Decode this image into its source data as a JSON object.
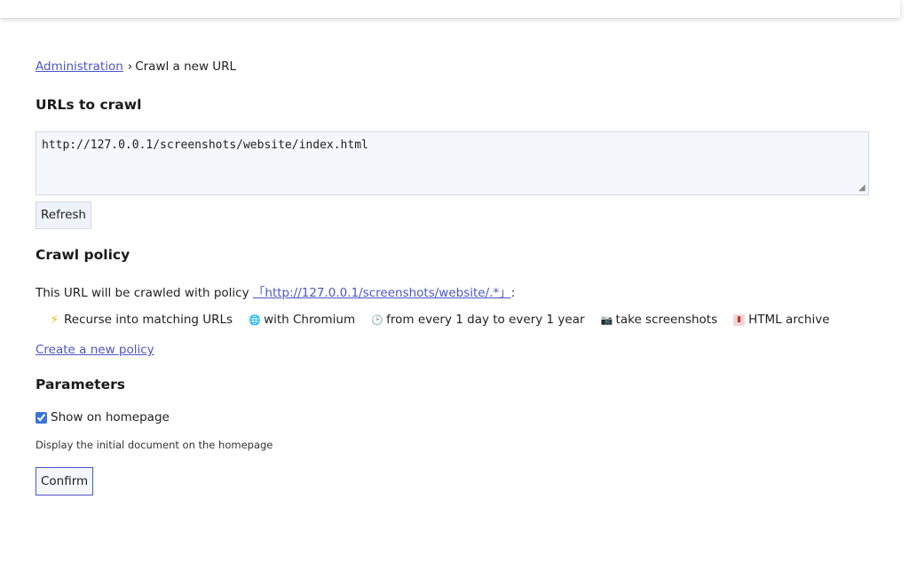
{
  "breadcrumb": {
    "parent": "Administration",
    "separator": "›",
    "current": "Crawl a new URL"
  },
  "urls": {
    "heading": "URLs to crawl",
    "value": "http://127.0.0.1/screenshots/website/index.html",
    "refresh_label": "Refresh"
  },
  "policy": {
    "heading": "Crawl policy",
    "intro": "This URL will be crawled with policy",
    "policy_link": "「http://127.0.0.1/screenshots/website/.*」",
    "colon": ":",
    "items": [
      {
        "icon": "lightning-icon",
        "label": "Recurse into matching URLs"
      },
      {
        "icon": "globe-icon",
        "label": "with Chromium"
      },
      {
        "icon": "clock-icon",
        "label": "from every 1 day to every 1 year"
      },
      {
        "icon": "camera-icon",
        "label": "take screenshots"
      },
      {
        "icon": "archive-icon",
        "label": "HTML archive"
      }
    ],
    "create_link": "Create a new policy"
  },
  "parameters": {
    "heading": "Parameters",
    "show_on_homepage_label": "Show on homepage",
    "show_on_homepage_checked": true,
    "help_text": "Display the initial document on the homepage",
    "confirm_label": "Confirm"
  },
  "colors": {
    "link": "#4b57c5",
    "input_bg": "#f4f8fc",
    "input_border": "#cfd8e3"
  }
}
